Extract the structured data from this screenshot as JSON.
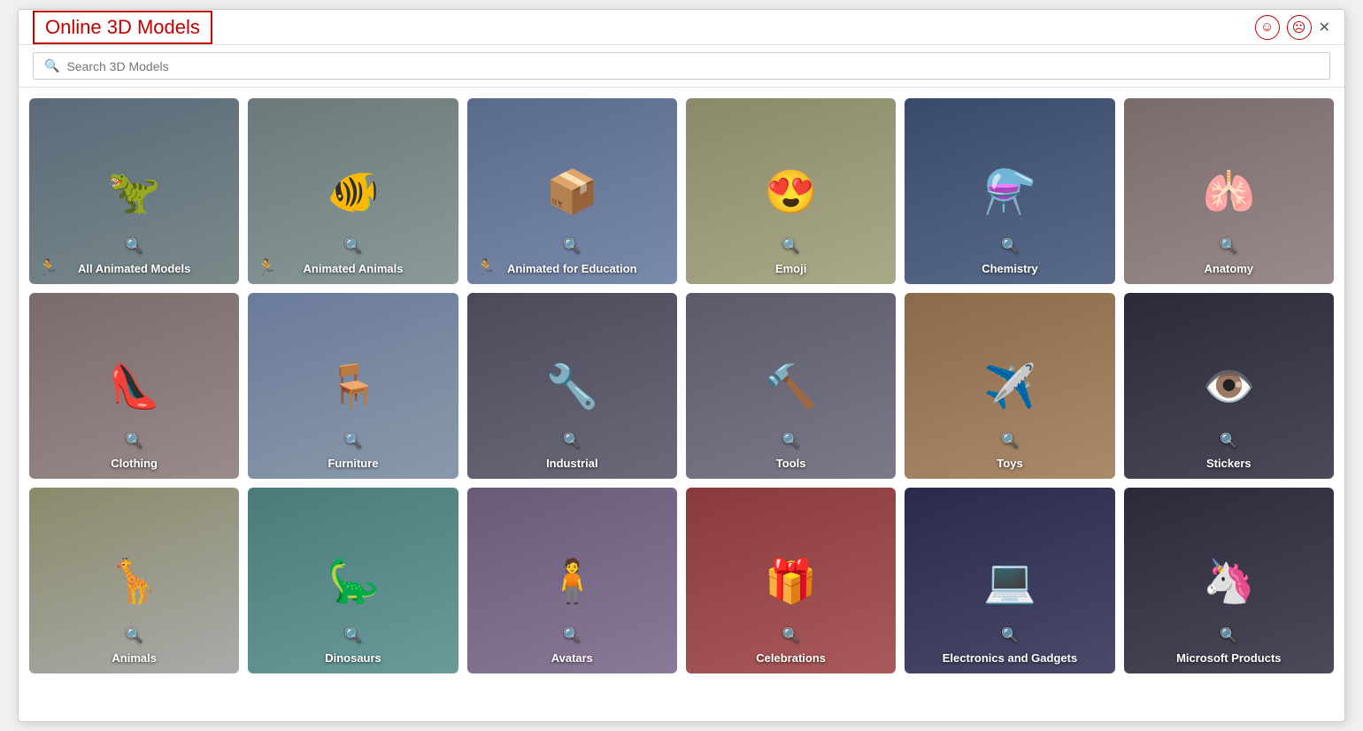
{
  "window": {
    "title": "Online 3D Models",
    "close_label": "✕"
  },
  "titlebar": {
    "feedback_positive": "☺",
    "feedback_negative": "☹"
  },
  "search": {
    "placeholder": "Search 3D Models"
  },
  "categories": [
    {
      "id": "all-animated",
      "label": "All Animated Models",
      "bg": "bg-dark-gray",
      "animated": true,
      "emoji": "🦖"
    },
    {
      "id": "animated-animals",
      "label": "Animated Animals",
      "bg": "bg-med-gray",
      "animated": true,
      "emoji": "🐠"
    },
    {
      "id": "animated-education",
      "label": "Animated for Education",
      "bg": "bg-blue-gray",
      "animated": true,
      "emoji": "📦"
    },
    {
      "id": "emoji",
      "label": "Emoji",
      "bg": "bg-yellow-gray",
      "animated": false,
      "emoji": "😍"
    },
    {
      "id": "chemistry",
      "label": "Chemistry",
      "bg": "bg-dark-blue",
      "animated": false,
      "emoji": "⚗️"
    },
    {
      "id": "anatomy",
      "label": "Anatomy",
      "bg": "bg-dark-med",
      "animated": false,
      "emoji": "🫁"
    },
    {
      "id": "clothing",
      "label": "Clothing",
      "bg": "bg-dark-med",
      "animated": false,
      "emoji": "👠"
    },
    {
      "id": "furniture",
      "label": "Furniture",
      "bg": "bg-blue-stripe",
      "animated": false,
      "emoji": "🪑"
    },
    {
      "id": "industrial",
      "label": "Industrial",
      "bg": "bg-dark",
      "animated": false,
      "emoji": "🔧"
    },
    {
      "id": "tools",
      "label": "Tools",
      "bg": "bg-gray-tools",
      "animated": false,
      "emoji": "🔨"
    },
    {
      "id": "toys",
      "label": "Toys",
      "bg": "bg-orange",
      "animated": false,
      "emoji": "✈️"
    },
    {
      "id": "stickers",
      "label": "Stickers",
      "bg": "bg-dark-sticker",
      "animated": false,
      "emoji": "👁️"
    },
    {
      "id": "animals",
      "label": "Animals",
      "bg": "bg-tan",
      "animated": false,
      "emoji": "🦒"
    },
    {
      "id": "dinosaurs",
      "label": "Dinosaurs",
      "bg": "bg-teal",
      "animated": false,
      "emoji": "🦕"
    },
    {
      "id": "avatars",
      "label": "Avatars",
      "bg": "bg-purple",
      "animated": false,
      "emoji": "🧍"
    },
    {
      "id": "celebrations",
      "label": "Celebrations",
      "bg": "bg-red",
      "animated": false,
      "emoji": "🎁"
    },
    {
      "id": "electronics-gadgets",
      "label": "Electronics and Gadgets",
      "bg": "bg-dark-elec",
      "animated": false,
      "emoji": "💻"
    },
    {
      "id": "microsoft-products",
      "label": "Microsoft Products",
      "bg": "bg-dark2",
      "animated": false,
      "emoji": "🦄"
    }
  ]
}
